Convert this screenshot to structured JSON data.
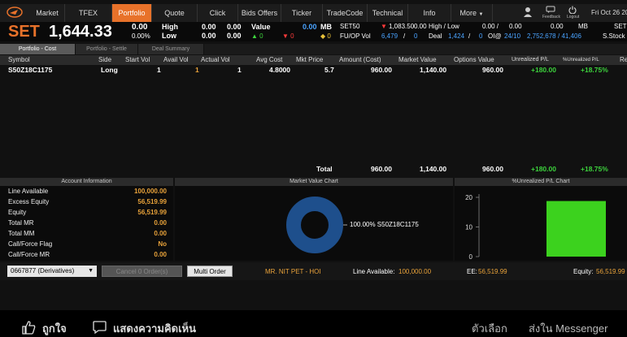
{
  "nav": {
    "items": [
      "Market",
      "TFEX",
      "Portfolio",
      "Quote",
      "Click",
      "Bids Offers",
      "Ticker",
      "TradeCode",
      "Technical",
      "Info",
      "More"
    ],
    "active_index": 2,
    "feedback": "Feedback",
    "logout": "Logout",
    "date": "Fri Oct 26 20"
  },
  "index": {
    "name": "SET",
    "value": "1,644.33",
    "change": "0.00",
    "change_pct": "0.00%",
    "high_label": "High",
    "low_label": "Low",
    "high_vals": [
      "0.00",
      "0.00"
    ],
    "low_vals": [
      "0.00",
      "0.00"
    ],
    "value_label": "Value",
    "value_amt": "0.00",
    "value_unit": "MB",
    "up": "0",
    "down": "0",
    "unch": "0",
    "set50": "SET50",
    "set50_change": "1,083.50",
    "set50_change_sign": "▼",
    "set50_val": "0.00",
    "hl_label": "High / Low",
    "hl_val1": "0.00 /",
    "hl_val2": "0.00",
    "mb_val": "0.00",
    "mb_unit": "MB",
    "right_label1": "SET",
    "fuop_label": "FU/OP Vol",
    "fuop_val1": "6,479",
    "fuop_sep": "/",
    "fuop_val2": "0",
    "deal_label": "Deal",
    "deal_val1": "1,424",
    "deal_sep": "/",
    "deal_val2": "0",
    "oi_label": "OI@",
    "oi_val1": "24/10",
    "oi_val2": "2,752,678",
    "oi_val3": "/ 41,406",
    "right_label2": "S.Stock"
  },
  "tabs": [
    "Portfolio - Cost",
    "Portfolio - Settle",
    "Deal Summary"
  ],
  "table": {
    "headers": [
      "Symbol",
      "Side",
      "Start Vol",
      "Avail Vol",
      "Actual Vol",
      "Avg Cost",
      "Mkt Price",
      "Amount (Cost)",
      "Market Value",
      "Options Value",
      "Unrealized P/L",
      "%Unrealized P/L",
      "Re"
    ],
    "row": {
      "symbol": "S50Z18C1175",
      "side": "Long",
      "start_vol": "1",
      "avail_vol": "1",
      "actual_vol": "1",
      "avg_cost": "4.8000",
      "mkt_price": "5.7",
      "amount_cost": "960.00",
      "market_value": "1,140.00",
      "options_value": "960.00",
      "unrealized_pl": "+180.00",
      "pct_unrealized_pl": "+18.75%"
    },
    "total": {
      "label": "Total",
      "amount_cost": "960.00",
      "market_value": "1,140.00",
      "options_value": "960.00",
      "unrealized_pl": "+180.00",
      "pct_unrealized_pl": "+18.75%"
    }
  },
  "account": {
    "title": "Account Information",
    "items": [
      {
        "label": "Line Available",
        "value": "100,000.00"
      },
      {
        "label": "Excess Equity",
        "value": "56,519.99"
      },
      {
        "label": "Equity",
        "value": "56,519.99"
      },
      {
        "label": "Total MR",
        "value": "0.00"
      },
      {
        "label": "Total MM",
        "value": "0.00"
      },
      {
        "label": "Call/Force Flag",
        "value": "No"
      },
      {
        "label": "Call/Force MR",
        "value": "0.00"
      }
    ]
  },
  "market_value_chart": {
    "title": "Market Value Chart"
  },
  "unrealized_chart": {
    "title": "%Unrealized P/L Chart"
  },
  "chart_data": [
    {
      "type": "pie",
      "title": "Market Value Chart",
      "slices": [
        {
          "label": "S50Z18C1175",
          "value": 100.0,
          "display": "100.00% S50Z18C1175"
        }
      ],
      "color": "#1e4f8c"
    },
    {
      "type": "bar",
      "title": "%Unrealized P/L Chart",
      "categories": [
        "S50Z18C1175"
      ],
      "values": [
        18.75
      ],
      "ylim": [
        0,
        20
      ],
      "yticks": [
        "20",
        "10",
        "0"
      ],
      "color": "#3cd21e"
    }
  ],
  "footer": {
    "account_select": "0667877 (Derivatives)",
    "cancel_button": "Cancel 0 Order(s)",
    "multi_order_button": "Multi Order",
    "user_name": "MR. NIT PET - HOI",
    "line_available_label": "Line Available:",
    "line_available_value": "100,000.00",
    "ee_label": "EE:",
    "ee_value": "56,519.99",
    "equity_label": "Equity:",
    "equity_value": "56,519.99"
  },
  "social": {
    "like": "ถูกใจ",
    "comment": "แสดงความคิดเห็น",
    "options": "ตัวเลือก",
    "messenger": "ส่งใน Messenger"
  }
}
